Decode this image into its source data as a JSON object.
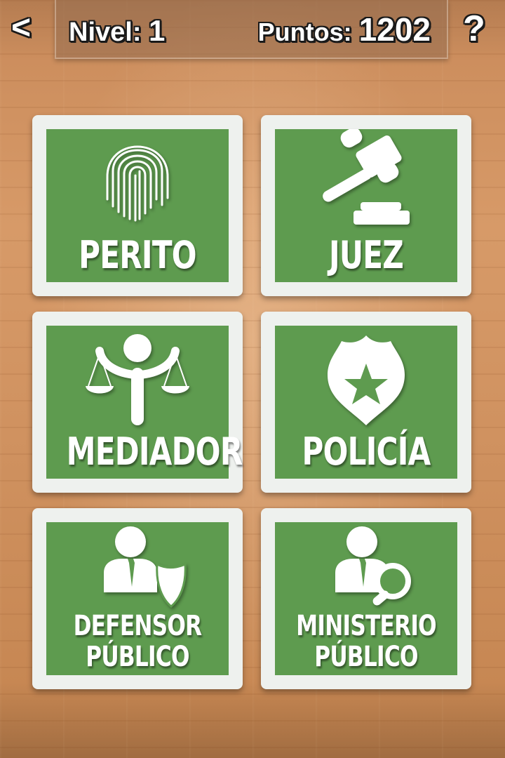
{
  "header": {
    "back_label": "<",
    "level_label": "Nivel:",
    "level_value": "1",
    "points_label": "Puntos:",
    "points_value": "1202",
    "help_label": "?"
  },
  "colors": {
    "card_frame": "#eef1ee",
    "card_fill": "#5e9b4f",
    "text": "#ffffff"
  },
  "cards": [
    {
      "label": "PERITO",
      "icon": "fingerprint-icon"
    },
    {
      "label": "JUEZ",
      "icon": "gavel-icon"
    },
    {
      "label": "MEDIADOR",
      "icon": "scales-person-icon"
    },
    {
      "label": "POLICÍA",
      "icon": "police-badge-icon"
    },
    {
      "label_line1": "DEFENSOR",
      "label_line2": "PÚBLICO",
      "icon": "person-shield-icon"
    },
    {
      "label_line1": "MINISTERIO",
      "label_line2": "PÚBLICO",
      "icon": "person-magnifier-icon"
    }
  ]
}
